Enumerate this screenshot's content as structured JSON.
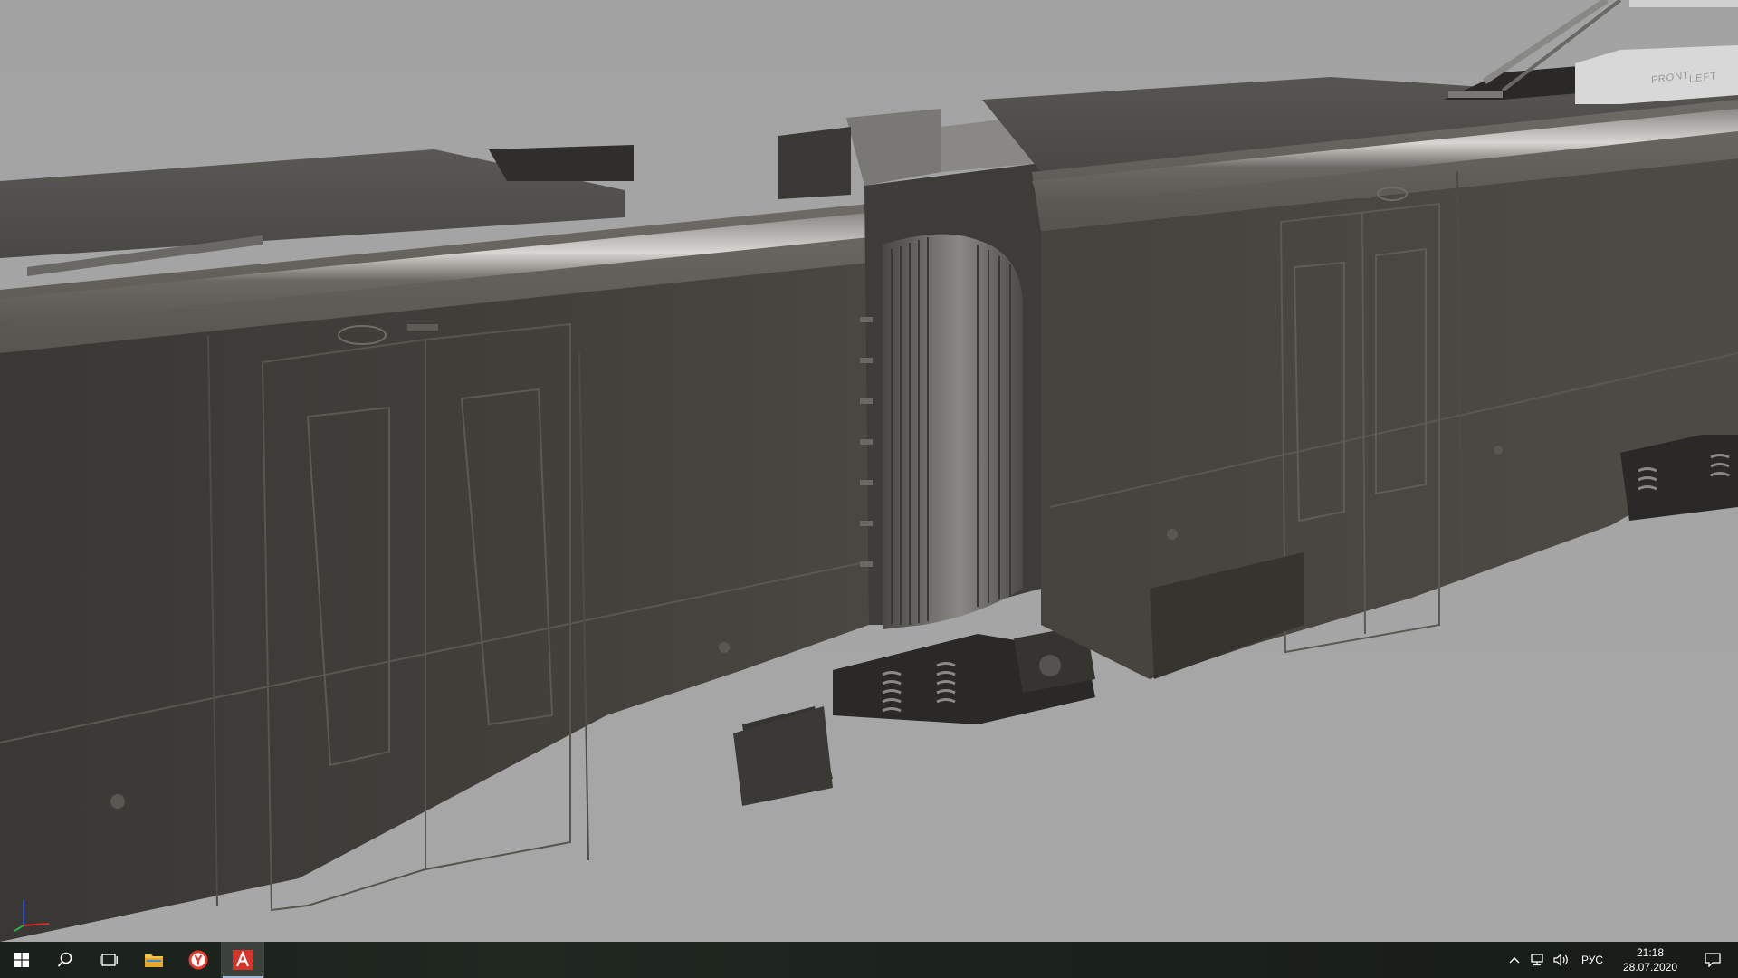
{
  "viewport": {
    "viewcube": {
      "front_label": "FRONT",
      "left_label": "LEFT"
    }
  },
  "taskbar": {
    "start_icon": "windows-logo-icon",
    "search_icon": "search-icon",
    "task_view_icon": "task-view-icon",
    "pinned_apps": [
      {
        "name": "file-explorer",
        "icon": "folder-icon",
        "color": "#f5c342"
      },
      {
        "name": "yandex-browser",
        "icon": "yandex-browser-icon",
        "color": "#e23b2e"
      },
      {
        "name": "autodesk-app",
        "icon": "autodesk-a-icon",
        "color": "#d6332b",
        "active": true
      }
    ],
    "tray": {
      "overflow_icon": "chevron-up-icon",
      "network_icon": "network-icon",
      "volume_icon": "speaker-icon",
      "language": "РУС",
      "time": "21:18",
      "date": "28.07.2020",
      "notifications_icon": "action-center-icon"
    }
  }
}
